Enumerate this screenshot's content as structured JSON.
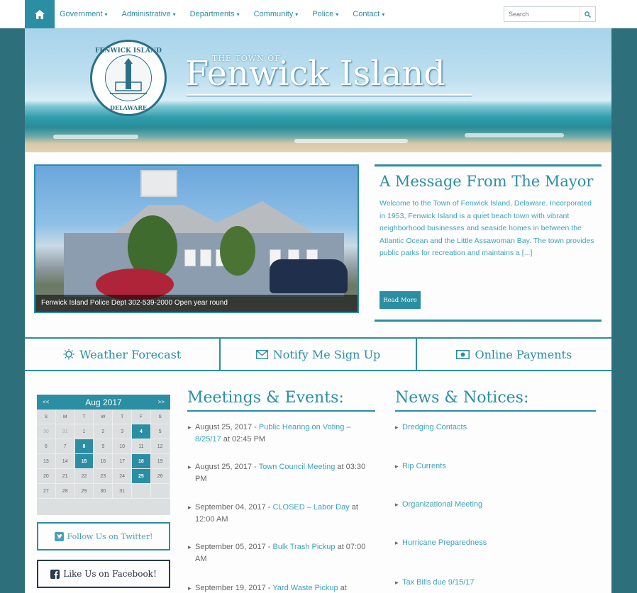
{
  "nav": {
    "home_icon": "home-icon",
    "items": [
      {
        "label": "Government"
      },
      {
        "label": "Administrative"
      },
      {
        "label": "Departments"
      },
      {
        "label": "Community"
      },
      {
        "label": "Police"
      },
      {
        "label": "Contact"
      }
    ],
    "search_placeholder": "Search",
    "search_icon": "search-icon"
  },
  "header": {
    "pre_title": "THE TOWN OF",
    "title": "Fenwick Island",
    "seal_top": "FENWICK ISLAND",
    "seal_bottom": "DELAWARE"
  },
  "feature": {
    "caption": "Fenwick Island Police Dept 302-539-2000 Open year round"
  },
  "mayor": {
    "title": "A Message From The Mayor",
    "text": "Welcome to the Town of Fenwick Island, Delaware. Incorporated in 1953, Fenwick Island is a quiet beach town with vibrant neighborhood businesses and seaside homes in between the Atlantic Ocean and the Little Assawoman Bay. The town provides public parks for recreation and maintains a [...]",
    "button": "Read More"
  },
  "quick_links": [
    {
      "label": "Weather Forecast",
      "icon": "sun-icon"
    },
    {
      "label": "Notify Me Sign Up",
      "icon": "envelope-icon"
    },
    {
      "label": "Online Payments",
      "icon": "money-icon"
    }
  ],
  "calendar": {
    "prev": "<<",
    "next": ">>",
    "month": "Aug 2017",
    "days_of_week": [
      "S",
      "M",
      "T",
      "W",
      "T",
      "F",
      "S"
    ],
    "weeks": [
      [
        {
          "d": "30",
          "m": true
        },
        {
          "d": "31",
          "m": true
        },
        {
          "d": "1"
        },
        {
          "d": "2"
        },
        {
          "d": "3"
        },
        {
          "d": "4",
          "h": true
        },
        {
          "d": "5"
        }
      ],
      [
        {
          "d": "6"
        },
        {
          "d": "7"
        },
        {
          "d": "8",
          "h": true
        },
        {
          "d": "9"
        },
        {
          "d": "10"
        },
        {
          "d": "11"
        },
        {
          "d": "12"
        }
      ],
      [
        {
          "d": "13"
        },
        {
          "d": "14"
        },
        {
          "d": "15",
          "h": true
        },
        {
          "d": "16"
        },
        {
          "d": "17"
        },
        {
          "d": "18",
          "h": true
        },
        {
          "d": "19"
        }
      ],
      [
        {
          "d": "20"
        },
        {
          "d": "21"
        },
        {
          "d": "22"
        },
        {
          "d": "23"
        },
        {
          "d": "24"
        },
        {
          "d": "25",
          "h": true
        },
        {
          "d": "26"
        }
      ],
      [
        {
          "d": "27"
        },
        {
          "d": "28"
        },
        {
          "d": "29"
        },
        {
          "d": "30"
        },
        {
          "d": "31"
        },
        {
          "d": "",
          "m": true
        },
        {
          "d": "",
          "m": true
        }
      ]
    ]
  },
  "social": {
    "twitter": "Follow Us on Twitter!",
    "facebook": "Like Us on Facebook!"
  },
  "meetings": {
    "title": "Meetings & Events:",
    "items": [
      {
        "date": "August 25, 2017 - ",
        "title": "Public Hearing on Voting – 8/25/17",
        "time": " at 02:45 PM"
      },
      {
        "date": "August 25, 2017 - ",
        "title": "Town Council Meeting",
        "time": " at 03:30 PM"
      },
      {
        "date": "September 04, 2017 - ",
        "title": "CLOSED – Labor Day",
        "time": " at 12:00 AM"
      },
      {
        "date": "September 05, 2017 - ",
        "title": "Bulk Trash Pickup",
        "time": " at 07:00 AM"
      },
      {
        "date": "September 19, 2017 - ",
        "title": "Yard Waste Pickup",
        "time": " at"
      }
    ]
  },
  "news": {
    "title": "News & Notices:",
    "items": [
      "Dredging Contacts",
      "Rip Currents",
      "Organizational Meeting",
      "Hurricane Preparedness",
      "Tax Bills due 9/15/17"
    ]
  },
  "colors": {
    "accent": "#2b8ea3",
    "background": "#2e6f7c",
    "link": "#3da3b8"
  }
}
